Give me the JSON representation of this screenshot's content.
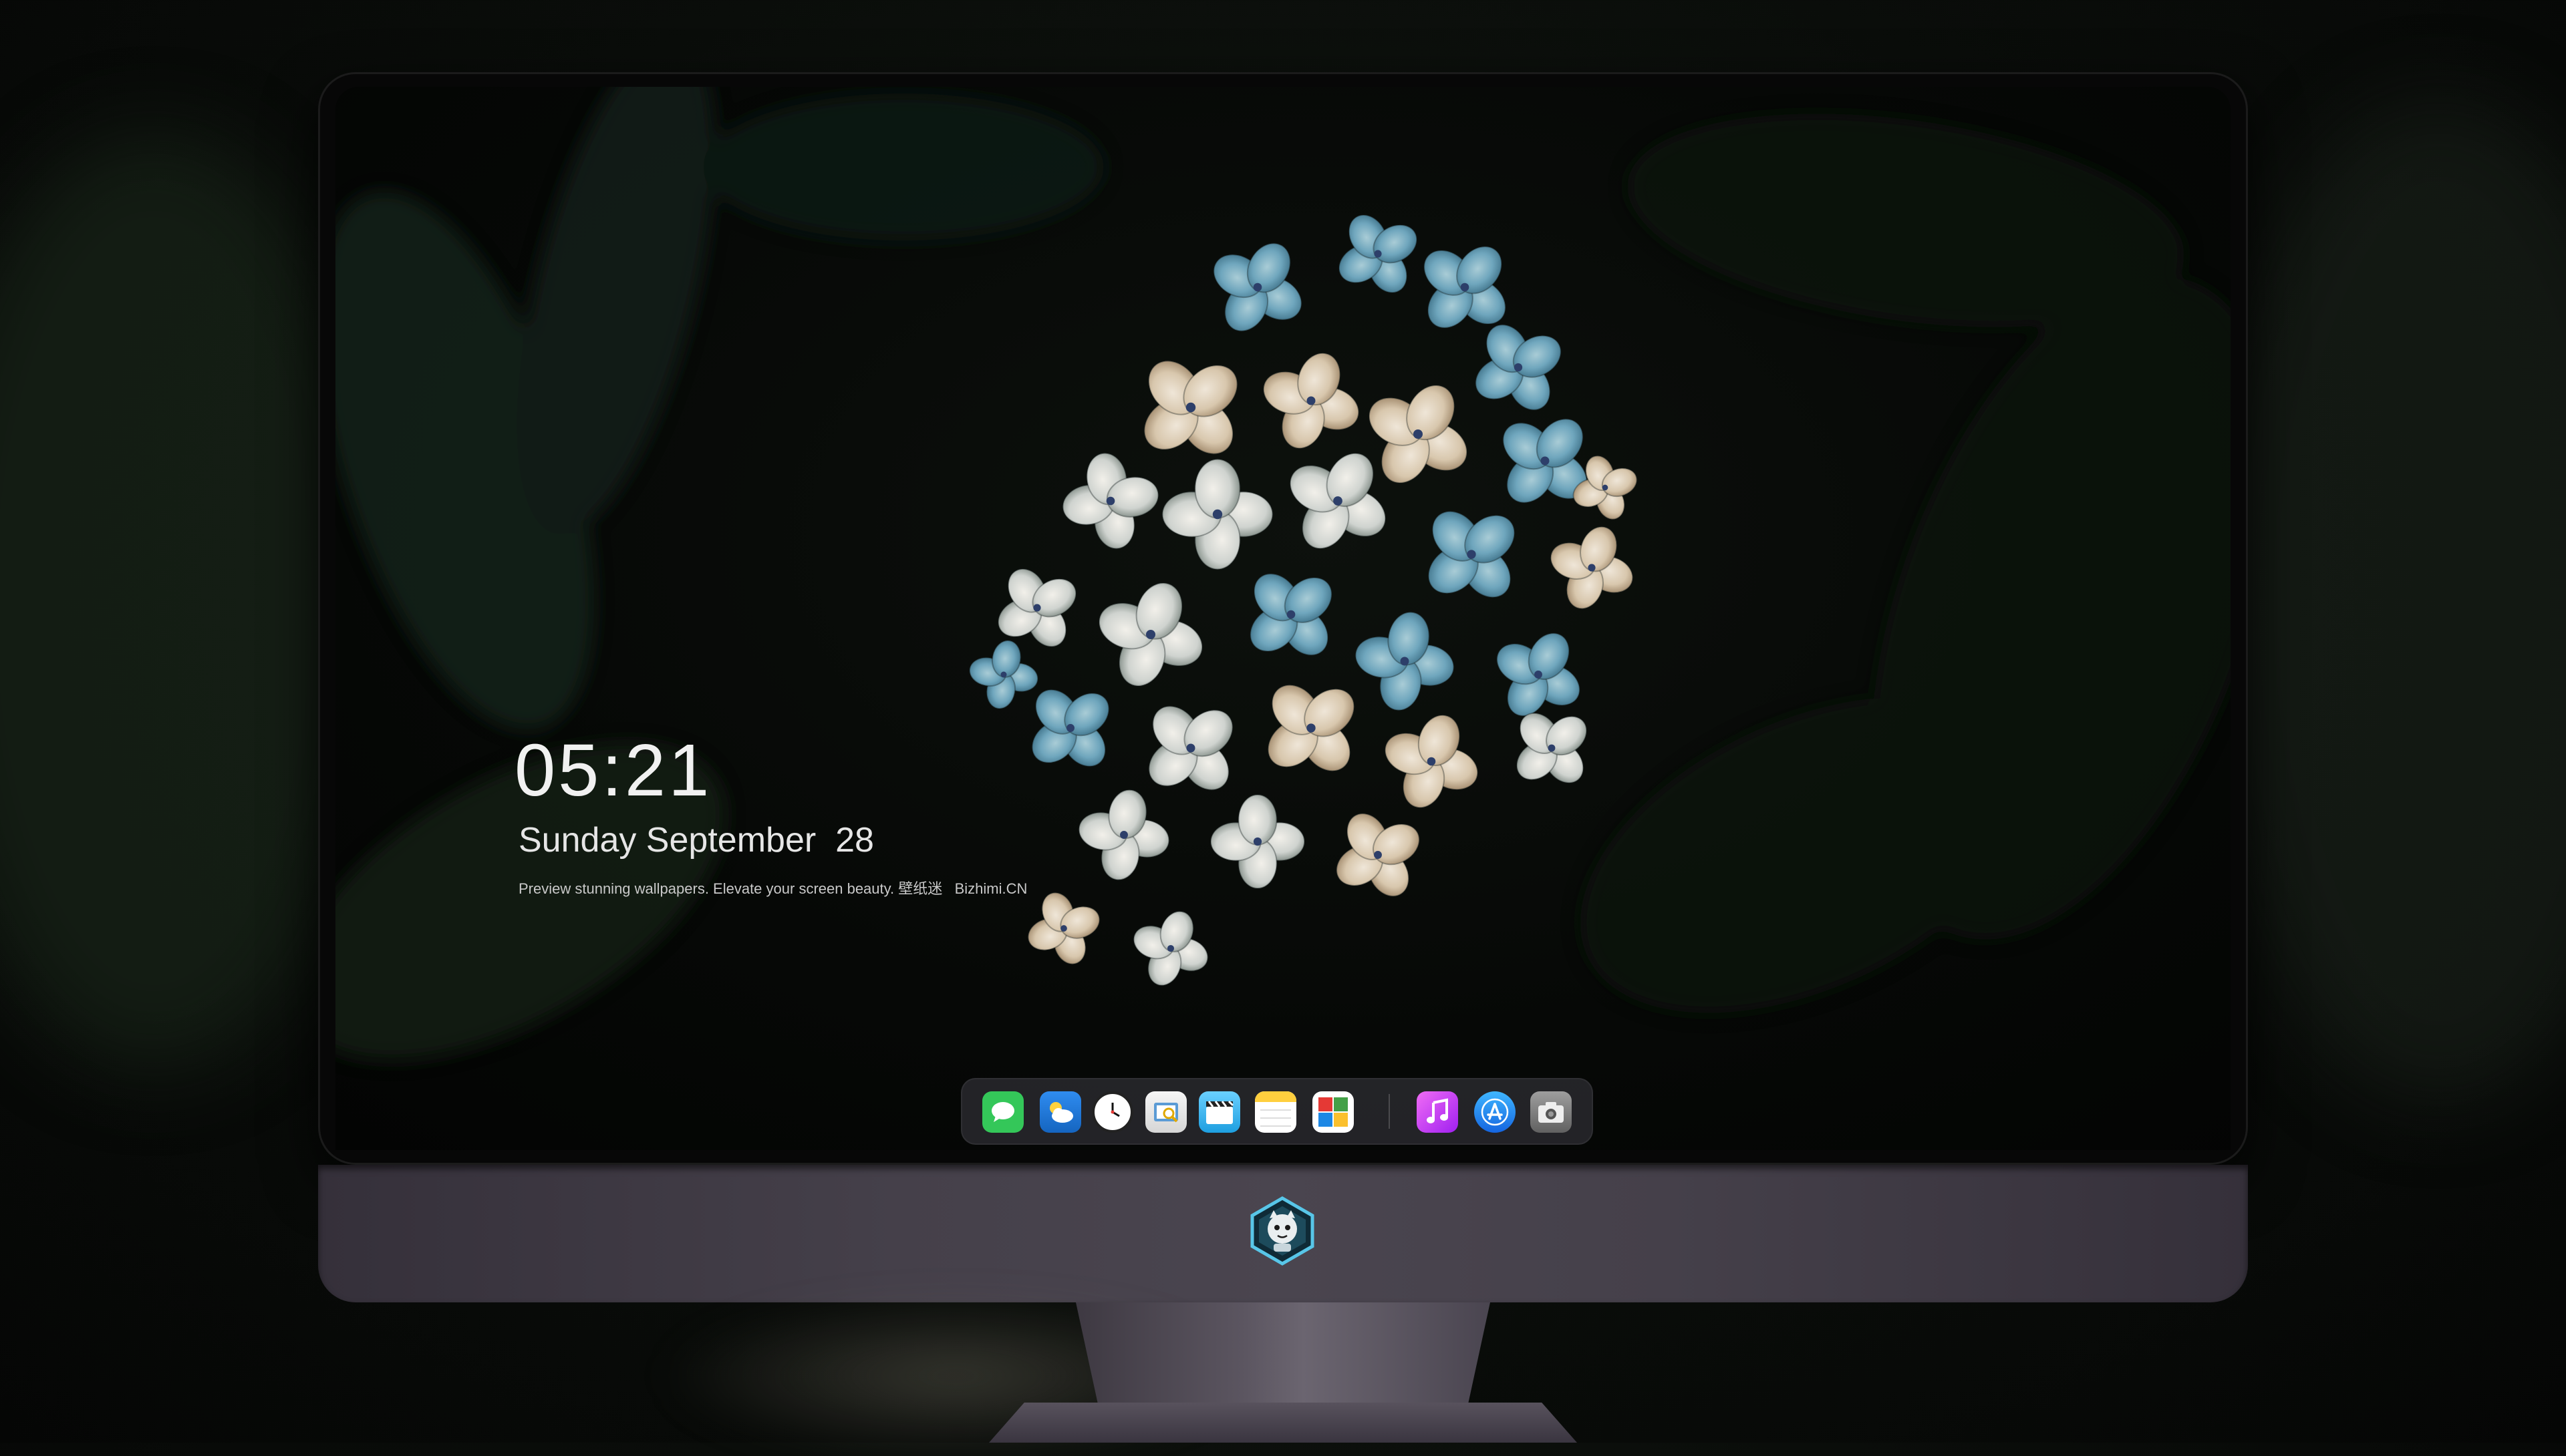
{
  "lockscreen": {
    "time": "05:21",
    "date": "Sunday September  28",
    "caption": "Preview stunning wallpapers. Elevate your screen beauty. 壁纸迷   Bizhimi.CN"
  },
  "dock": {
    "apps": [
      {
        "name": "Messages",
        "icon": "messages-icon",
        "color": "#34c759"
      },
      {
        "name": "Weather",
        "icon": "weather-icon",
        "color": "#1e88e5"
      },
      {
        "name": "Clock",
        "icon": "clock-icon",
        "color": "#111111"
      },
      {
        "name": "Preview",
        "icon": "preview-icon",
        "color": "#d9b84a"
      },
      {
        "name": "Clips",
        "icon": "clips-icon",
        "color": "#4fc3f7"
      },
      {
        "name": "Notes",
        "icon": "notes-icon",
        "color": "#ffd54f"
      },
      {
        "name": "Photo Booth",
        "icon": "photobooth-icon",
        "color": "#e53935"
      },
      {
        "name": "iTunes",
        "icon": "music-icon",
        "color": "#e040fb"
      },
      {
        "name": "App Store",
        "icon": "appstore-icon",
        "color": "#2196f3"
      },
      {
        "name": "Screenshot",
        "icon": "camera-icon",
        "color": "#757575"
      }
    ]
  },
  "colors": {
    "accent_dark": "#070707",
    "chin": "#45404a"
  }
}
